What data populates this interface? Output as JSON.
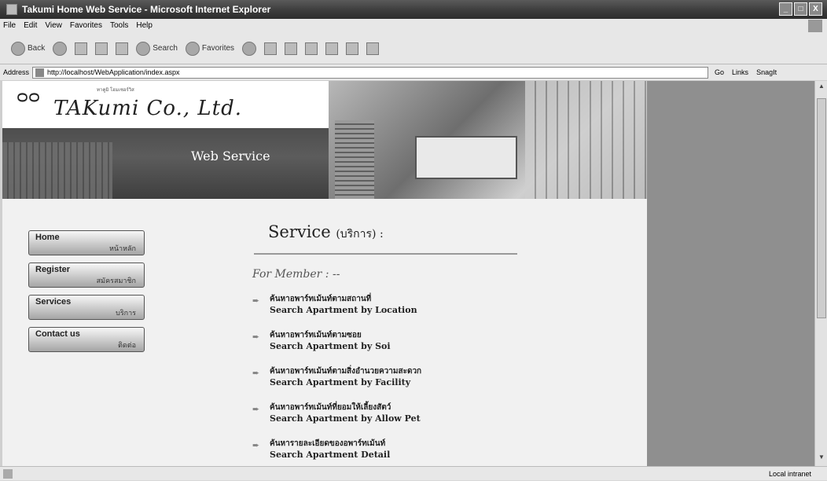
{
  "window": {
    "title": "Takumi Home Web Service - Microsoft Internet Explorer",
    "buttons": [
      "_",
      "□",
      "X"
    ]
  },
  "menu": [
    "File",
    "Edit",
    "View",
    "Favorites",
    "Tools",
    "Help"
  ],
  "toolbar": {
    "back": "Back",
    "search": "Search",
    "favorites": "Favorites"
  },
  "address": {
    "label": "Address",
    "url": "http://localhost/WebApplication/index.aspx",
    "go": "Go",
    "links": "Links",
    "snagit": "SnagIt"
  },
  "site": {
    "logo": "TAKumi Co., Ltd.",
    "logo_small": "ทาคูมิ โฮมเซอร์วิส",
    "banner": "Web Service",
    "nav": [
      {
        "en": "Home",
        "th": "หน้าหลัก"
      },
      {
        "en": "Register",
        "th": "สมัครสมาชิก"
      },
      {
        "en": "Services",
        "th": "บริการ"
      },
      {
        "en": "Contact us",
        "th": "ติดต่อ"
      }
    ],
    "service_title": "Service",
    "service_title_th": "(บริการ) :",
    "for_member": "For Member : --",
    "links": [
      {
        "th": "ค้นหาอพาร์ทเม้นท์ตามสถานที่",
        "en": "Search Apartment by Location"
      },
      {
        "th": "ค้นหาอพาร์ทเม้นท์ตามซอย",
        "en": "Search Apartment by Soi"
      },
      {
        "th": "ค้นหาอพาร์ทเม้นท์ตามสิ่งอำนวยความสะดวก",
        "en": "Search Apartment by Facility"
      },
      {
        "th": "ค้นหาอพาร์ทเม้นท์ที่ยอมให้เลี้ยงสัตว์",
        "en": "Search Apartment by Allow Pet"
      },
      {
        "th": "ค้นหารายละเอียดของอพาร์ทเม้นท์",
        "en": "Search Apartment Detail"
      }
    ]
  },
  "status": {
    "zone": "Local intranet"
  }
}
